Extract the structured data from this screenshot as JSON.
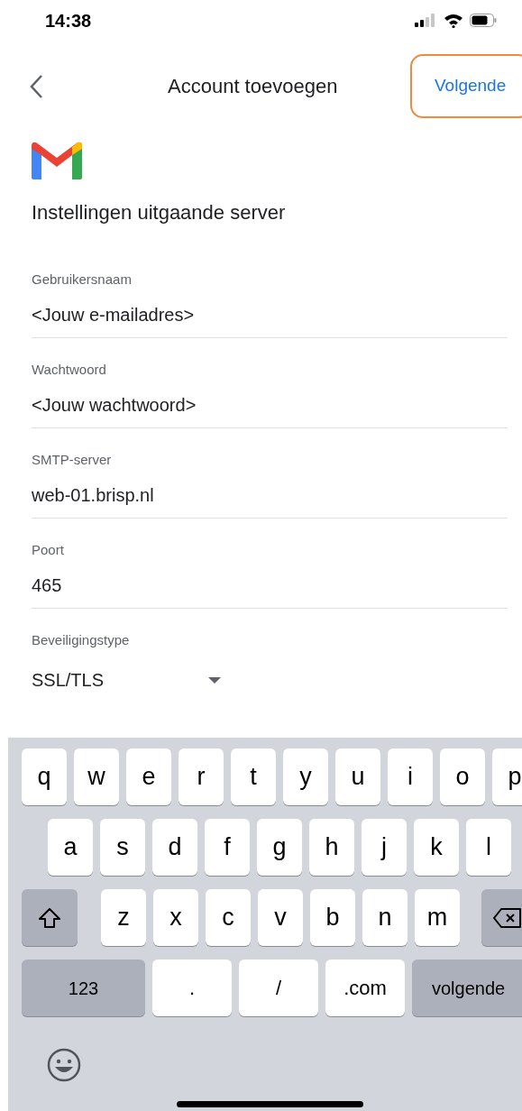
{
  "status_bar": {
    "time": "14:38"
  },
  "header": {
    "title": "Account toevoegen",
    "next_button": {
      "label": "Volgende",
      "highlighted": true
    }
  },
  "heading": "Instellingen uitgaande server",
  "fields": [
    {
      "kind": "text",
      "label": "Gebruikersnaam",
      "value": "<Jouw e-mailadres>"
    },
    {
      "kind": "text",
      "label": "Wachtwoord",
      "value": "<Jouw wachtwoord>"
    },
    {
      "kind": "text",
      "label": "SMTP-server",
      "value": "web-01.brisp.nl"
    },
    {
      "kind": "text",
      "label": "Poort",
      "value": "465"
    },
    {
      "kind": "select",
      "label": "Beveiligingstype",
      "value": "SSL/TLS"
    }
  ],
  "keyboard": {
    "rows": [
      {
        "keys": [
          {
            "kind": "letter",
            "label": "q"
          },
          {
            "kind": "letter",
            "label": "w"
          },
          {
            "kind": "letter",
            "label": "e"
          },
          {
            "kind": "letter",
            "label": "r"
          },
          {
            "kind": "letter",
            "label": "t"
          },
          {
            "kind": "letter",
            "label": "y"
          },
          {
            "kind": "letter",
            "label": "u"
          },
          {
            "kind": "letter",
            "label": "i"
          },
          {
            "kind": "letter",
            "label": "o"
          },
          {
            "kind": "letter",
            "label": "p"
          }
        ]
      },
      {
        "keys": [
          {
            "kind": "letter",
            "label": "a"
          },
          {
            "kind": "letter",
            "label": "s"
          },
          {
            "kind": "letter",
            "label": "d"
          },
          {
            "kind": "letter",
            "label": "f"
          },
          {
            "kind": "letter",
            "label": "g"
          },
          {
            "kind": "letter",
            "label": "h"
          },
          {
            "kind": "letter",
            "label": "j"
          },
          {
            "kind": "letter",
            "label": "k"
          },
          {
            "kind": "letter",
            "label": "l"
          }
        ]
      },
      {
        "keys": [
          {
            "kind": "shift"
          },
          {
            "kind": "letter",
            "label": "z"
          },
          {
            "kind": "letter",
            "label": "x"
          },
          {
            "kind": "letter",
            "label": "c"
          },
          {
            "kind": "letter",
            "label": "v"
          },
          {
            "kind": "letter",
            "label": "b"
          },
          {
            "kind": "letter",
            "label": "n"
          },
          {
            "kind": "letter",
            "label": "m"
          },
          {
            "kind": "delete"
          }
        ]
      },
      {
        "keys": [
          {
            "kind": "function",
            "label": "123"
          },
          {
            "kind": "wide",
            "label": "."
          },
          {
            "kind": "wide",
            "label": "/"
          },
          {
            "kind": "wide",
            "label": ".com"
          },
          {
            "kind": "return",
            "label": "volgende"
          }
        ]
      }
    ]
  }
}
